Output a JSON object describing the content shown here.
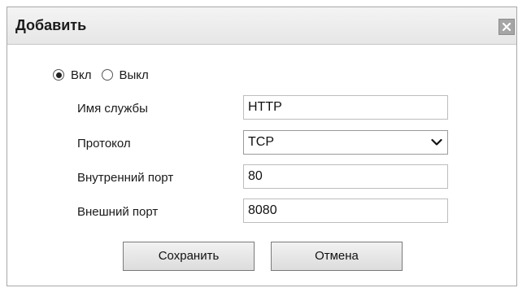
{
  "dialog": {
    "title": "Добавить",
    "close_icon": "close-icon"
  },
  "status": {
    "options": [
      {
        "label": "Вкл",
        "selected": true
      },
      {
        "label": "Выкл",
        "selected": false
      }
    ]
  },
  "form": {
    "service_name": {
      "label": "Имя службы",
      "value": "HTTP"
    },
    "protocol": {
      "label": "Протокол",
      "value": "TCP",
      "icon": "chevron-down-icon"
    },
    "internal_port": {
      "label": "Внутренний порт",
      "value": "80"
    },
    "external_port": {
      "label": "Внешний порт",
      "value": "8080"
    }
  },
  "buttons": {
    "save_label": "Сохранить",
    "cancel_label": "Отмена"
  }
}
